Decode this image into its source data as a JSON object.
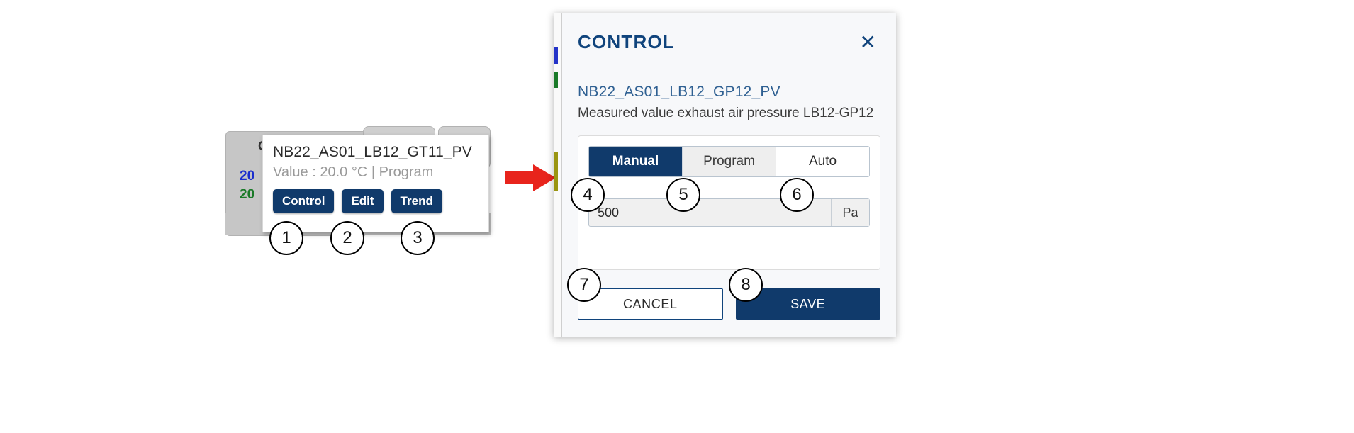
{
  "hmi_background": {
    "title": "C",
    "value_blue": "20",
    "value_green": "20"
  },
  "tooltip": {
    "tag": "NB22_AS01_LB12_GT11_PV",
    "value_line": "Value : 20.0 °C | Program",
    "buttons": [
      {
        "label": "Control"
      },
      {
        "label": "Edit"
      },
      {
        "label": "Trend"
      }
    ]
  },
  "callouts": {
    "one": "1",
    "two": "2",
    "three": "3",
    "four": "4",
    "five": "5",
    "six": "6",
    "seven": "7",
    "eight": "8"
  },
  "arrow": {
    "name": "red-right-arrow",
    "color": "#e8241c"
  },
  "dialog": {
    "title": "CONTROL",
    "close_label": "✕",
    "tag": "NB22_AS01_LB12_GP12_PV",
    "description": "Measured value exhaust air pressure LB12-GP12",
    "modes": [
      {
        "label": "Manual",
        "state": "selected"
      },
      {
        "label": "Program",
        "state": "disabled"
      },
      {
        "label": "Auto",
        "state": "normal"
      }
    ],
    "value": {
      "current": "500",
      "placeholder": "500",
      "unit": "Pa"
    },
    "footer": {
      "cancel_label": "CANCEL",
      "save_label": "SAVE"
    }
  },
  "colors": {
    "brand_dark_blue": "#103a6b",
    "title_blue": "#10447c",
    "tag_blue": "#2f6092",
    "arrow_red": "#e8241c",
    "value_blue": "#1b2ecd",
    "value_green": "#1a7a28"
  }
}
